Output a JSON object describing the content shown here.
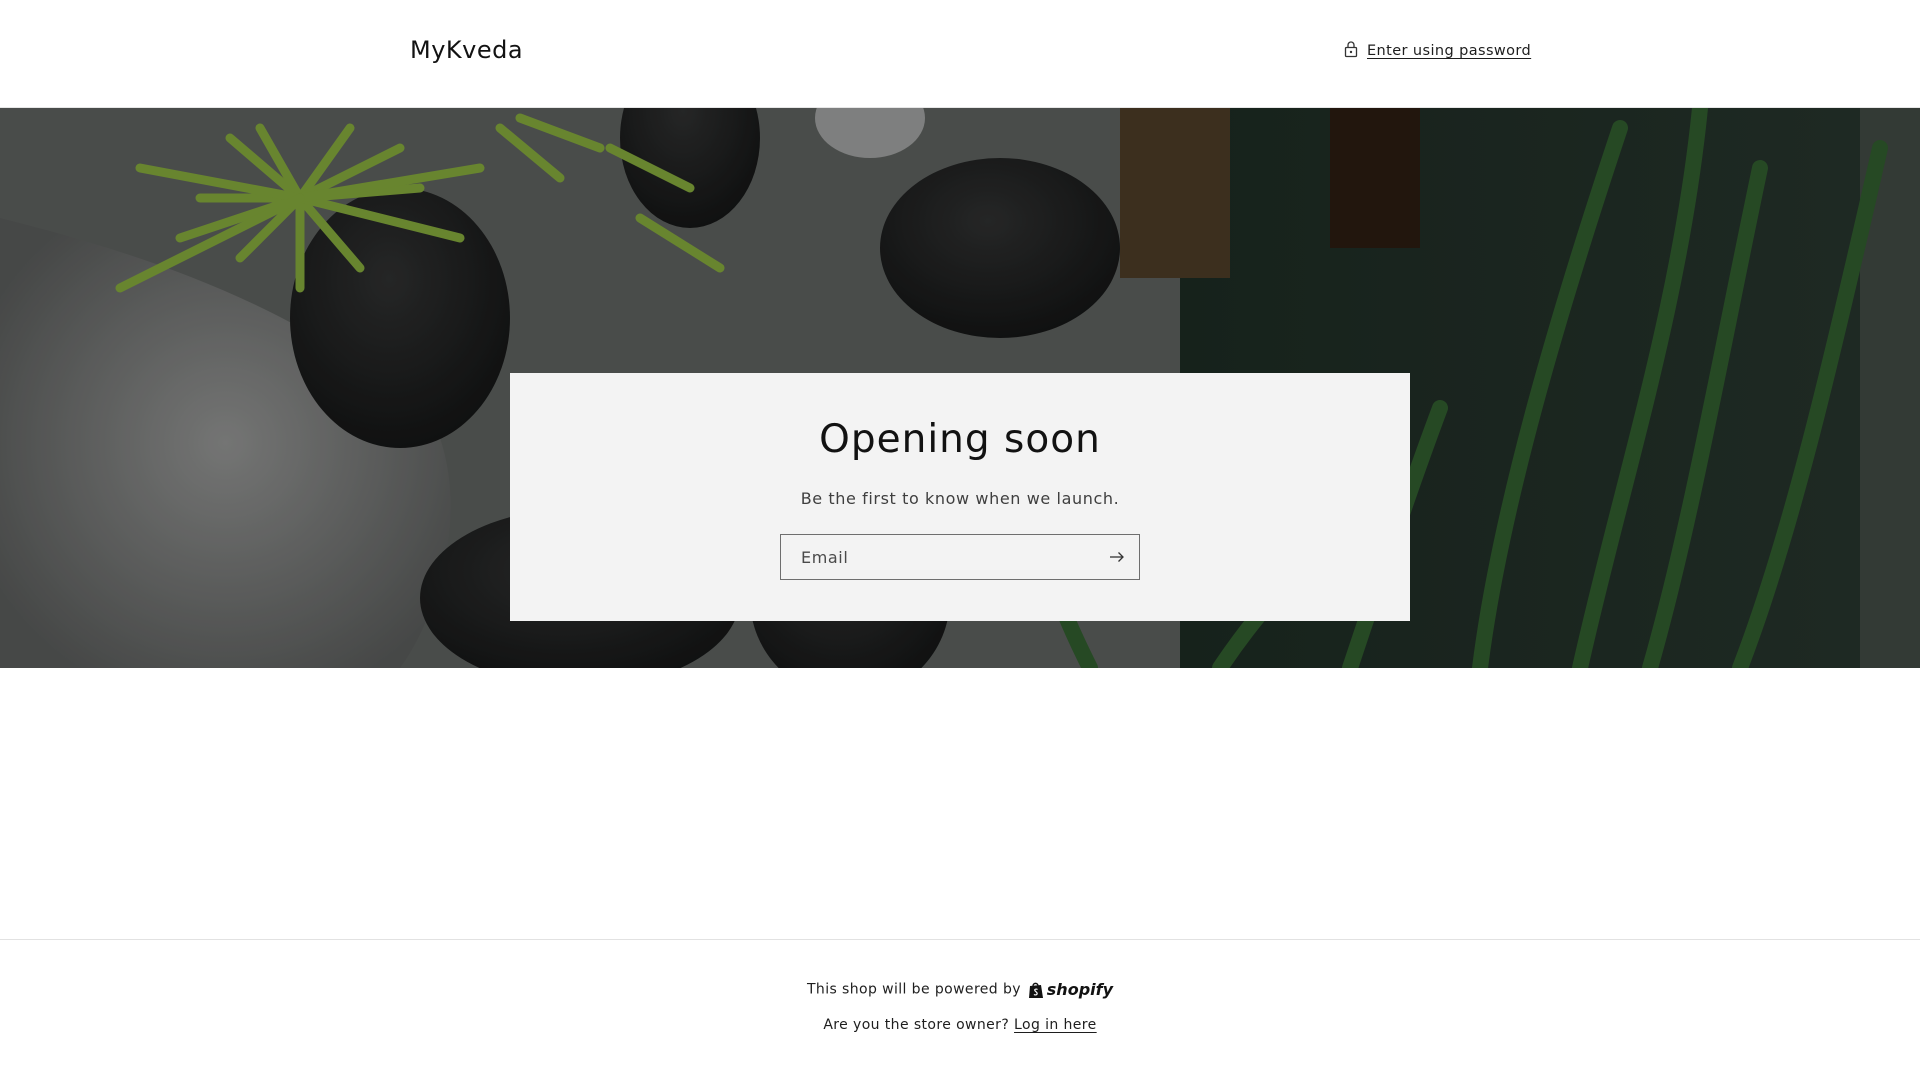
{
  "header": {
    "brand": "MyKveda",
    "password_link": {
      "label": "Enter using password",
      "icon": "lock-icon"
    }
  },
  "hero": {
    "background": "spa stones, towel and green leaves photo (darkened)",
    "card": {
      "title": "Opening soon",
      "subtitle": "Be the first to know when we launch.",
      "email": {
        "placeholder": "Email",
        "value": "",
        "submit_icon": "arrow-right-icon"
      }
    }
  },
  "footer": {
    "powered_text": "This shop will be powered by",
    "powered_brand": "shopify",
    "owner_text": "Are you the store owner?",
    "login_link": "Log in here"
  },
  "colors": {
    "card_bg": "#f3f3f3",
    "text": "#121212",
    "divider": "#e2e2e2"
  }
}
